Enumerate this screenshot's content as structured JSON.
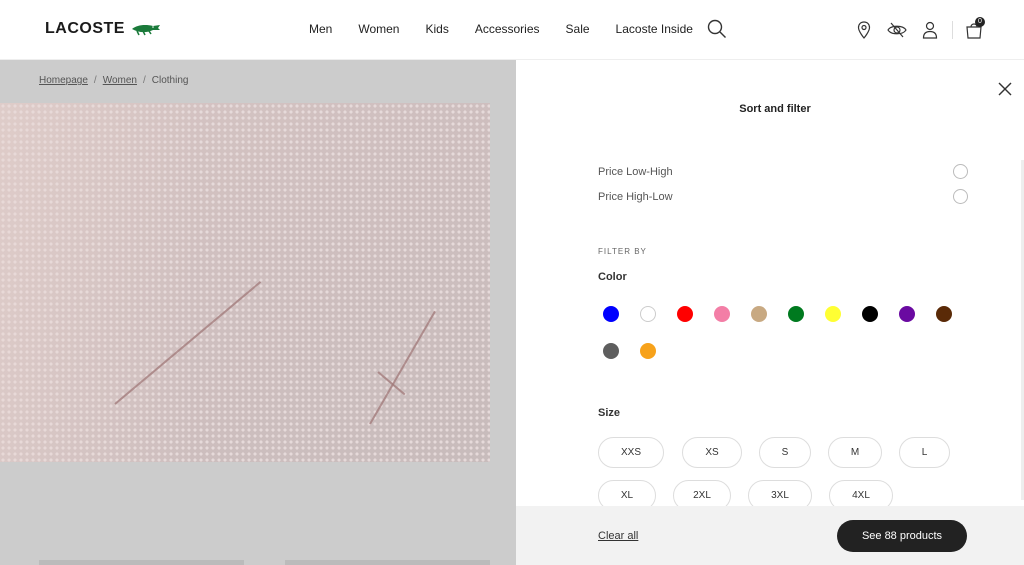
{
  "header": {
    "logo_text": "LACOSTE",
    "nav": [
      "Men",
      "Women",
      "Kids",
      "Accessories",
      "Sale",
      "Lacoste Inside"
    ],
    "cart_count": "0"
  },
  "breadcrumb": {
    "home": "Homepage",
    "women": "Women",
    "current": "Clothing",
    "separator": "/"
  },
  "panel": {
    "title": "Sort and filter",
    "sort_options": [
      "Price Low-High",
      "Price High-Low"
    ],
    "filter_by": "FILTER BY",
    "color_label": "Color",
    "colors": [
      "#0000ff",
      "#ffffff",
      "#ff0000",
      "#f37ea6",
      "#c8a982",
      "#007a1f",
      "#ffff33",
      "#000000",
      "#6a0aa1",
      "#5a2a07",
      "#5e5e5e",
      "#f7a21b"
    ],
    "size_label": "Size",
    "sizes": [
      "XXS",
      "XS",
      "S",
      "M",
      "L",
      "XL",
      "2XL",
      "3XL",
      "4XL"
    ],
    "clear_all": "Clear all",
    "see_products": "See 88 products"
  },
  "theme": {
    "accent": "#222222",
    "brand_green": "#1a7a3a"
  }
}
